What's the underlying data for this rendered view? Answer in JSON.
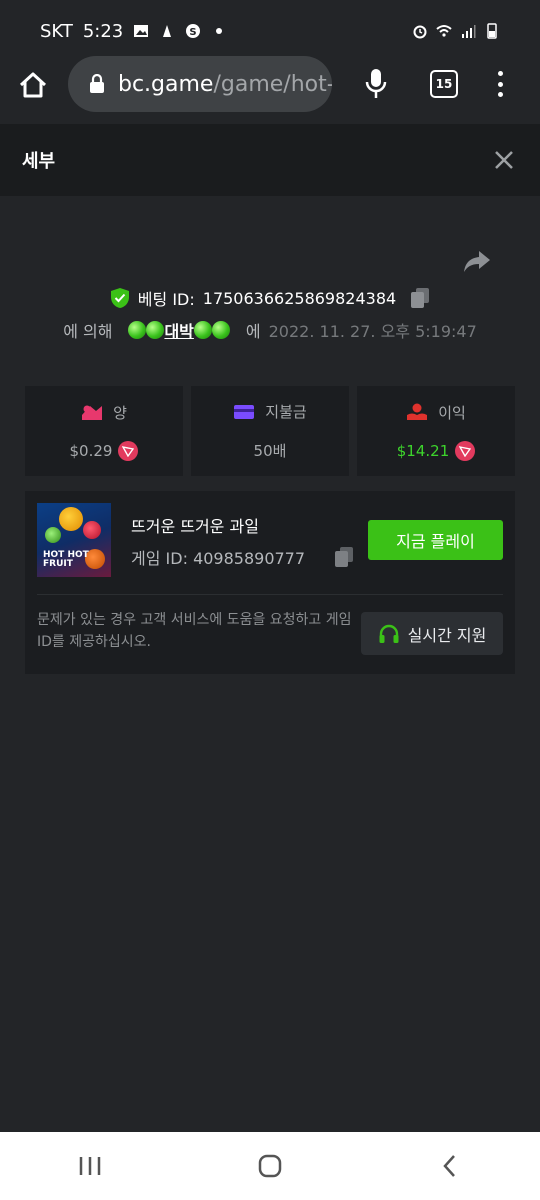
{
  "status_bar": {
    "carrier": "SKT",
    "time": "5:23"
  },
  "browser": {
    "url_host": "bc.game",
    "url_path": "/game/hot-",
    "tab_count": "15"
  },
  "modal": {
    "title": "세부",
    "bet_id_label": "베팅 ID:",
    "bet_id": "1750636625869824384",
    "by_label": "에 의해",
    "username": "대박",
    "at_label": "에",
    "date": "2022. 11. 27. 오후 5:19:47"
  },
  "stats": [
    {
      "label": "양",
      "value": "$0.29",
      "icon": "bet-amount-icon",
      "color": "#e8386d"
    },
    {
      "label": "지불금",
      "value": "50배",
      "icon": "card-icon",
      "color": "#7a4cff"
    },
    {
      "label": "이익",
      "value": "$14.21",
      "icon": "profit-icon",
      "color": "#e0322d"
    }
  ],
  "game": {
    "thumb_text_1": "HOT HOT",
    "thumb_text_2": "FRUIT",
    "name": "뜨거운 뜨거운 과일",
    "id_label": "게임 ID:",
    "id": "40985890777",
    "play_label": "지금 플레이"
  },
  "support": {
    "text": "문제가 있는 경우 고객 서비스에 도움을 요청하고 게임 ID를 제공하십시오.",
    "button_label": "실시간 지원"
  },
  "colors": {
    "accent_green": "#3bc117",
    "background": "#232528",
    "card": "#1b1d20",
    "trx_red": "#e23a5e"
  }
}
